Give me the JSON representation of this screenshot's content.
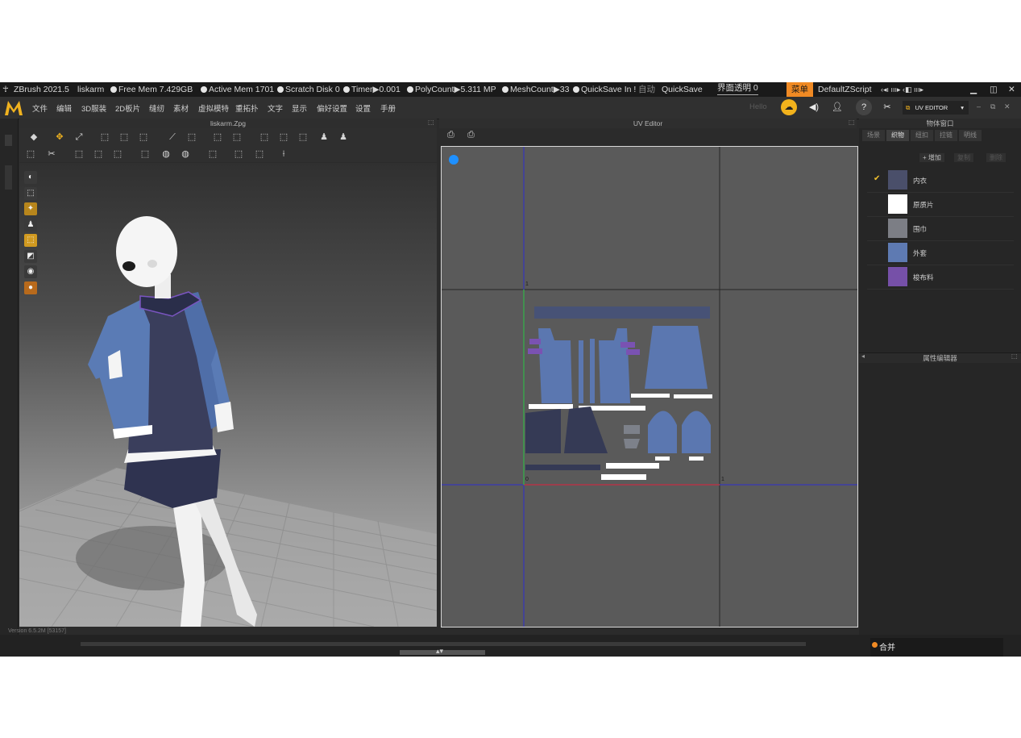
{
  "titlebar": {
    "app": "ZBrush 2021.5",
    "user": "liskarm",
    "free_mem": "Free Mem 7.429GB",
    "active_mem": "Active Mem 1701",
    "scratch": "Scratch Disk 0",
    "timer": "Timer▶0.001",
    "polycount": "PolyCount▶5.311 MP",
    "meshcount": "MeshCount▶33",
    "quicksave_in": "QuickSave In !",
    "auto": "自动",
    "quicksave": "QuickSave",
    "transparency": "界面透明 0",
    "menu_chip": "菜单",
    "script": "DefaultZScript",
    "nav_icons": "‹◂ı ııı▸ ‹◧ ııı▸"
  },
  "menubar": {
    "items": [
      "文件",
      "编辑",
      "3D服装",
      "2D板片",
      "缝纫",
      "素材",
      "虚拟模特",
      "重拓扑",
      "文字",
      "显示",
      "偏好设置",
      "设置",
      "手册"
    ],
    "right_hint": "Hello",
    "uv_editor_label": "UV EDITOR"
  },
  "viewport": {
    "title": "liskarm.Zpg"
  },
  "uv_editor": {
    "title": "UV Editor",
    "axis_one": "1",
    "axis_zero": "0"
  },
  "object_window": {
    "title": "物体窗口",
    "tabs": [
      "场景",
      "织物",
      "纽扣",
      "拉链",
      "明线"
    ],
    "active_tab": 1,
    "add_button": "+ 增加",
    "copy_button": "复制",
    "delete_button": "删除",
    "materials": [
      {
        "name": "内衣",
        "color": "#4a4f6a",
        "checked": true
      },
      {
        "name": "原质片",
        "color": "#ffffff",
        "checked": false
      },
      {
        "name": "围巾",
        "color": "#7c7e85",
        "checked": false
      },
      {
        "name": "外套",
        "color": "#5e7ab2",
        "checked": false
      },
      {
        "name": "梭布料",
        "color": "#7650a8",
        "checked": false
      }
    ]
  },
  "property_editor": {
    "title": "属性编辑器"
  },
  "statusbar": {
    "version": "Version 6.5.2M [53157]",
    "merge_label": "合并"
  }
}
